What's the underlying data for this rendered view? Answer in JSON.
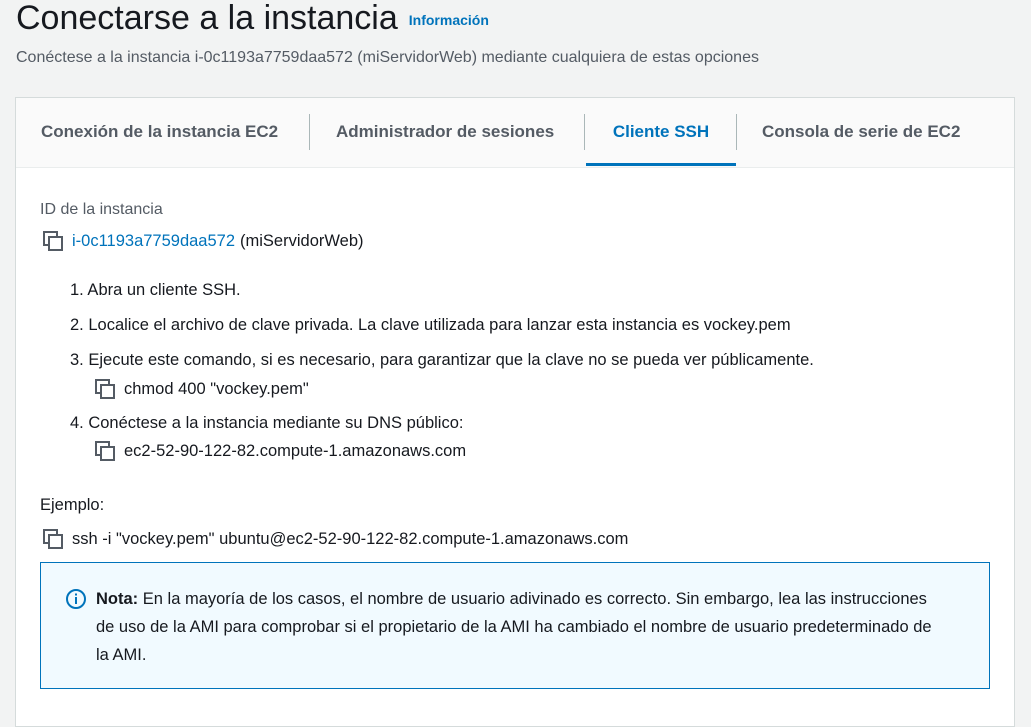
{
  "header": {
    "title": "Conectarse a la instancia",
    "info_link": "Información",
    "subtitle": "Conéctese a la instancia i-0c1193a7759daa572 (miServidorWeb) mediante cualquiera de estas opciones"
  },
  "tabs": [
    {
      "label": "Conexión de la instancia EC2",
      "active": false
    },
    {
      "label": "Administrador de sesiones",
      "active": false
    },
    {
      "label": "Cliente SSH",
      "active": true
    },
    {
      "label": "Consola de serie de EC2",
      "active": false
    }
  ],
  "instance": {
    "label": "ID de la instancia",
    "id": "i-0c1193a7759daa572",
    "name": "(miServidorWeb)"
  },
  "steps": [
    "1. Abra un cliente SSH.",
    "2. Localice el archivo de clave privada. La clave utilizada para lanzar esta instancia es vockey.pem",
    "3. Ejecute este comando, si es necesario, para garantizar que la clave no se pueda ver públicamente.",
    "4. Conéctese a la instancia mediante su DNS público:"
  ],
  "commands": {
    "chmod": "chmod 400 \"vockey.pem\"",
    "dns": "ec2-52-90-122-82.compute-1.amazonaws.com"
  },
  "example": {
    "label": "Ejemplo:",
    "command": "ssh -i \"vockey.pem\" ubuntu@ec2-52-90-122-82.compute-1.amazonaws.com"
  },
  "note": {
    "title": "Nota:",
    "text": " En la mayoría de los casos, el nombre de usuario adivinado es correcto. Sin embargo, lea las instrucciones de uso de la AMI para comprobar si el propietario de la AMI ha cambiado el nombre de usuario predeterminado de la AMI."
  },
  "colors": {
    "accent": "#0073bb",
    "note_bg": "#f1faff",
    "text": "#16191f",
    "muted": "#545b64"
  }
}
